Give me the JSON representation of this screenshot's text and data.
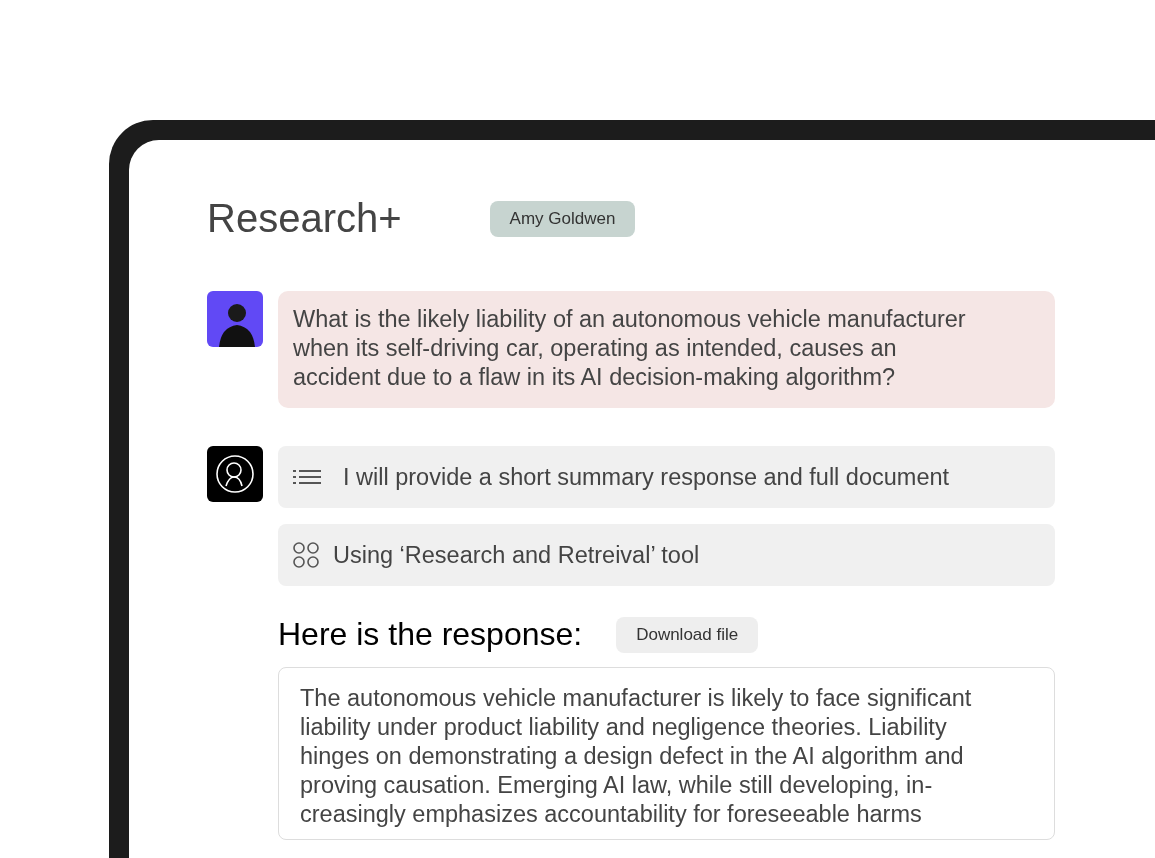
{
  "app": {
    "title": "Research+",
    "user_badge": "Amy Goldwen"
  },
  "question": {
    "text": "What is the likely liability of an autonomous vehicle manufacturer when its self-driving car, operating as intended, causes an accident due to a flaw in its AI decision-making algorithm?"
  },
  "steps": [
    {
      "kind": "list",
      "text": "I will provide a short summary response and full document"
    },
    {
      "kind": "tool",
      "text": "Using ‘Research and Retreival’ tool"
    }
  ],
  "response": {
    "heading": "Here is the response:",
    "download_button": "Download file",
    "lines": [
      "The autonomous vehicle manufacturer is likely to face significant",
      "liability under product liability and negligence theories. Liability",
      "hinges on demonstrating a design defect in the AI algorithm and",
      "proving causation. Emerging AI law, while still developing, in-",
      "creasingly emphasizes accountability for foreseeable harms"
    ]
  }
}
